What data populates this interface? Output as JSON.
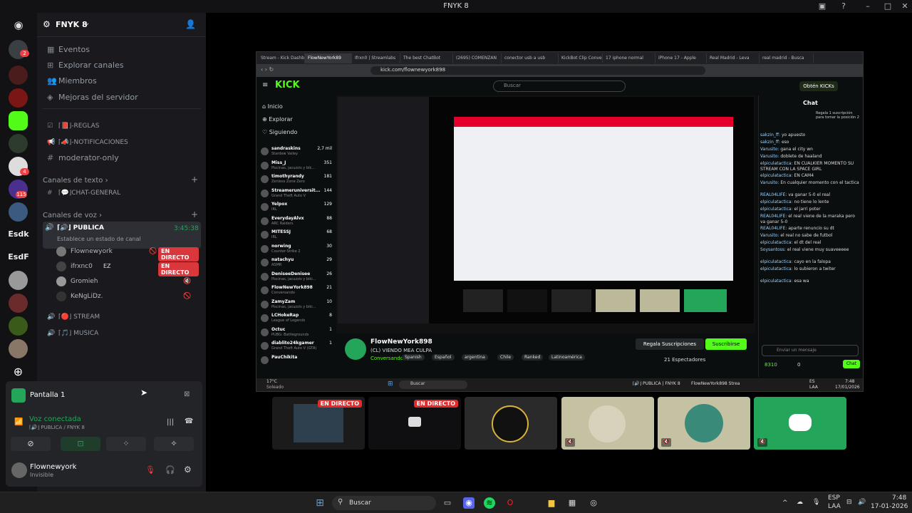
{
  "window": {
    "title": "FNYK 8"
  },
  "rail": {
    "servers": [
      {
        "label": "Esdk",
        "badge": ""
      },
      {
        "label": "EsdF",
        "badge": ""
      }
    ],
    "badges": [
      "2",
      "4",
      "115"
    ]
  },
  "sidebar": {
    "server_name": "FNYK 8",
    "menu": [
      "Eventos",
      "Explorar canales",
      "Miembros",
      "Mejoras del servidor"
    ],
    "text_top": [
      "⌈📕⌋-REGLAS",
      "⌈📣⌋-NOTIFICACIONES",
      "moderator-only"
    ],
    "cat_text": "Canales de texto",
    "text_channels": [
      "⌈💬⌋CHAT-GENERAL"
    ],
    "cat_voice": "Canales de voz",
    "voice_active": {
      "name": "⌈🔊⌋ PUBLICA",
      "time": "3:45:38",
      "status": "Establece un estado de canal"
    },
    "voice_users": [
      {
        "name": "Flownewyork",
        "live": "EN DIRECTO"
      },
      {
        "name": "ifrxnc0",
        "tag": "EZ",
        "live": "EN DIRECTO"
      },
      {
        "name": "Gromieh",
        "live": ""
      },
      {
        "name": "KeNgLiDz.",
        "live": ""
      }
    ],
    "voice_other": [
      "⌈🔴⌋ STREAM",
      "⌈🎵⌋ MUSICA"
    ]
  },
  "panel": {
    "screen_title": "Pantalla 1",
    "voice_status": "Voz conectada",
    "voice_channel": "⌈🔊⌋ PUBLICA / FNYK 8",
    "user_name": "Flownewyork",
    "user_status": "Invisible"
  },
  "browser": {
    "tabs": [
      "Stream - Kick Dashb",
      "FlowNewYork89",
      "Ifrxn0 | Streamlabs",
      "The best ChatBot",
      "(2695) COMENZAN",
      "conector usb a usb",
      "KickBot Clip Conve",
      "17 iphone normal",
      "iPhone 17 - Apple",
      "Real Madrid - Leva",
      "real madrid - Busca"
    ],
    "url": "kick.com/flownewyork898",
    "search_placeholder": "Buscar",
    "obtain": "Obtén KICKs",
    "nav": [
      "Inicio",
      "Explorar",
      "Siguiendo"
    ],
    "streamers": [
      {
        "n": "sandraskins",
        "g": "Stardew Valley",
        "v": "2,7 mil"
      },
      {
        "n": "Miss_J",
        "g": "Piscinas, jacuzzis y bik...",
        "v": "351"
      },
      {
        "n": "timothyrandy",
        "g": "Zenless Zone Zero",
        "v": "181"
      },
      {
        "n": "Streameruniversit...",
        "g": "Grand Theft Auto V",
        "v": "144"
      },
      {
        "n": "Yelpox",
        "g": "IRL",
        "v": "129"
      },
      {
        "n": "EverydayAlvx",
        "g": "ARC Raiders",
        "v": "88"
      },
      {
        "n": "MITESSJ",
        "g": "IRL",
        "v": "68"
      },
      {
        "n": "norwing",
        "g": "Counter-Strike 2",
        "v": "30"
      },
      {
        "n": "natachyu",
        "g": "ASMR",
        "v": "29"
      },
      {
        "n": "DeniseeDenisee",
        "g": "Piscinas, jacuzzis y biki...",
        "v": "26"
      },
      {
        "n": "FlowNewYork898",
        "g": "Conversando",
        "v": "21"
      },
      {
        "n": "ZamyZam",
        "g": "Piscinas, jacuzzis y biki...",
        "v": "10"
      },
      {
        "n": "LCHokeRap",
        "g": "League of Legends",
        "v": "8"
      },
      {
        "n": "Octuc",
        "g": "PUBG: Battlegrounds",
        "v": "1"
      },
      {
        "n": "diablito24kgamer",
        "g": "Grand Theft Auto V (GTA)",
        "v": "1"
      },
      {
        "n": "PauChikita",
        "g": "",
        "v": ""
      }
    ],
    "stream_title": "FlowNewYork898",
    "stream_sub": "(CL) VIENDO MEA CULPA",
    "stream_cat": "Conversando",
    "stream_tags": [
      "Spanish",
      "Español",
      "argentina",
      "Chile",
      "Ranked",
      "Latinoamérica"
    ],
    "gift": "Regala Suscripciones",
    "subscribe": "Suscribirse",
    "viewers": "21 Espectadores",
    "chat_title": "Chat",
    "chat_pin": "Regala 1 suscripción para tomar la posición 2",
    "chat": [
      {
        "u": "sakzin_ff:",
        "t": " yo apuesto"
      },
      {
        "u": "sakzin_ff:",
        "t": " eso"
      },
      {
        "u": "Varusito:",
        "t": " gana el city wn"
      },
      {
        "u": "Varusito:",
        "t": " doblete de haaland"
      },
      {
        "u": "elpiculatactica:",
        "t": " EN CUALKIER MOMENTO SU STREAM CON LA SPACE GIRL"
      },
      {
        "u": "elpiculatactica:",
        "t": " EN CAM4"
      },
      {
        "u": "Varusito:",
        "t": " En cualquier momento con el tactica"
      },
      {
        "u": "REAL04LIFE:",
        "t": " va ganar 5-0 el real"
      },
      {
        "u": "elpiculatactica:",
        "t": " no tiene lo lente"
      },
      {
        "u": "elpiculatactica:",
        "t": " el jarri poter"
      },
      {
        "u": "REAL04LIFE:",
        "t": " el real viene de la maraka pero va ganar 5-0"
      },
      {
        "u": "REAL04LIFE:",
        "t": " aparte renuncio su dt"
      },
      {
        "u": "Varusito:",
        "t": " el real no sabe de futbol"
      },
      {
        "u": "elpiculatactica:",
        "t": " el dt del real"
      },
      {
        "u": "Soysantoss:",
        "t": " el real viene muy suaveeeee"
      },
      {
        "u": "elpiculatactica:",
        "t": " cayo en la falopa"
      },
      {
        "u": "elpiculatactica:",
        "t": " lo subieron a twiter"
      },
      {
        "u": "elpiculatactica:",
        "t": " esa wa"
      }
    ],
    "chat_placeholder": "Enviar un mensaje",
    "points": "8310",
    "zero": "0",
    "chat_btn": "Chat",
    "inner_taskbar_search": "Buscar",
    "inner_time": "7:48",
    "inner_date": "17/01/2026",
    "inner_lang": "ES",
    "inner_region": "LAA",
    "weather_temp": "17°C",
    "weather_desc": "Soleado",
    "inner_task_discord": "⌈🔊⌋ PUBLICA | FNYK 8",
    "inner_task_stream": "FlowNewYork898 Strea"
  },
  "tiles": [
    {
      "live": "EN DIRECTO"
    },
    {
      "live": "EN DIRECTO"
    }
  ],
  "taskbar": {
    "search": "Buscar",
    "lang1": "ESP",
    "lang2": "LAA",
    "time": "7:48",
    "date": "17-01-2026"
  },
  "colors": {
    "discord_blurple": "#5865f2",
    "kick_green": "#53fc18",
    "live_red": "#da373c",
    "online_green": "#23a55a"
  }
}
